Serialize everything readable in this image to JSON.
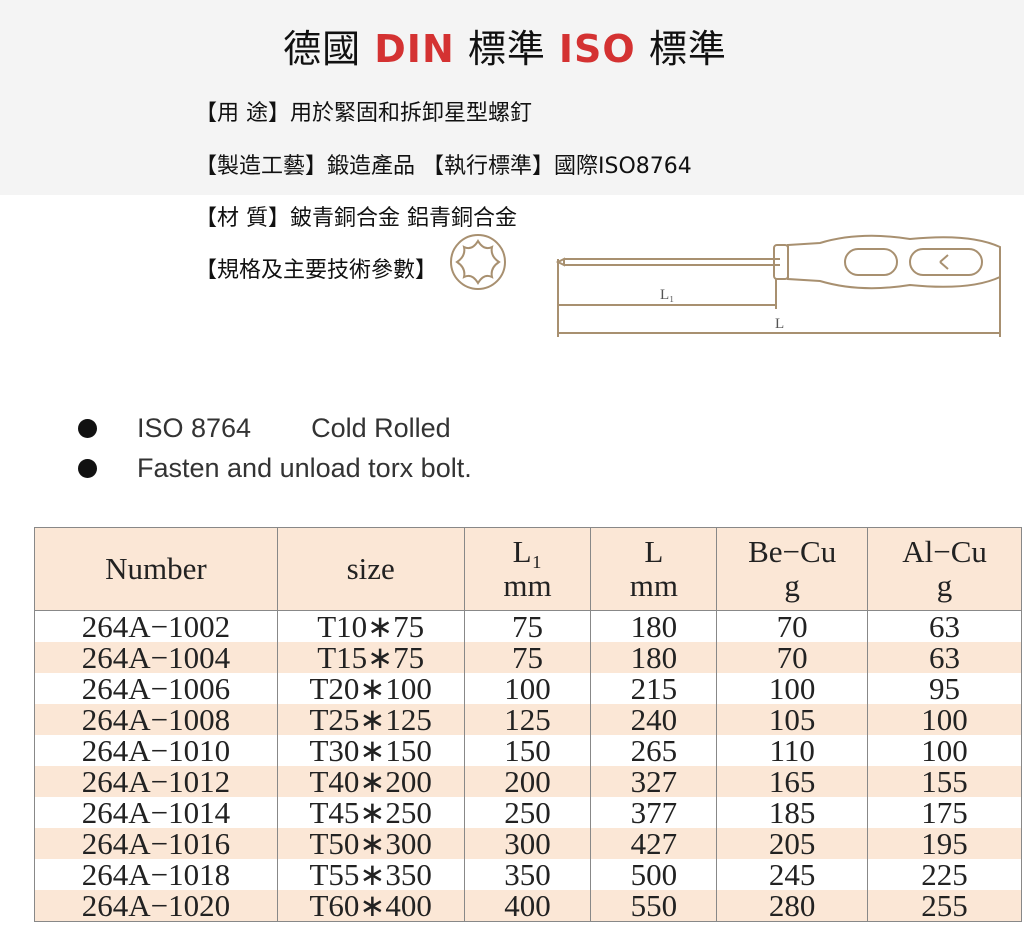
{
  "title": {
    "part1": "德國 ",
    "din": "DIN",
    "part2": " 標準 ",
    "iso": "ISO",
    "part3": " 標準"
  },
  "info": {
    "use_label": "【用 途】",
    "use_value": "用於緊固和拆卸星型螺釘",
    "process_label": "【製造工藝】",
    "process_value": "鍛造產品 ",
    "standard_label": "【執行標準】",
    "standard_value": "國際ISO8764",
    "material_label": "【材 質】",
    "material_value": "鈹青銅合金 鋁青銅合金",
    "spec_label": "【規格及主要技術參數】"
  },
  "drawing": {
    "l1_label": "L₁",
    "l_label": "L"
  },
  "bullets": {
    "b1_a": "ISO 8764",
    "b1_b": "Cold Rolled",
    "b2": "Fasten and unload torx bolt."
  },
  "table": {
    "headers": [
      {
        "l1": "Number",
        "l2": ""
      },
      {
        "l1": "size",
        "l2": ""
      },
      {
        "l1": "L₁",
        "l2": "mm"
      },
      {
        "l1": "L",
        "l2": "mm"
      },
      {
        "l1": "Be−Cu",
        "l2": "g"
      },
      {
        "l1": "Al−Cu",
        "l2": "g"
      }
    ],
    "rows": [
      [
        "264A−1002",
        "T10∗75",
        "75",
        "180",
        "70",
        "63"
      ],
      [
        "264A−1004",
        "T15∗75",
        "75",
        "180",
        "70",
        "63"
      ],
      [
        "264A−1006",
        "T20∗100",
        "100",
        "215",
        "100",
        "95"
      ],
      [
        "264A−1008",
        "T25∗125",
        "125",
        "240",
        "105",
        "100"
      ],
      [
        "264A−1010",
        "T30∗150",
        "150",
        "265",
        "110",
        "100"
      ],
      [
        "264A−1012",
        "T40∗200",
        "200",
        "327",
        "165",
        "155"
      ],
      [
        "264A−1014",
        "T45∗250",
        "250",
        "377",
        "185",
        "175"
      ],
      [
        "264A−1016",
        "T50∗300",
        "300",
        "427",
        "205",
        "195"
      ],
      [
        "264A−1018",
        "T55∗350",
        "350",
        "500",
        "245",
        "225"
      ],
      [
        "264A−1020",
        "T60∗400",
        "400",
        "550",
        "280",
        "255"
      ]
    ]
  }
}
